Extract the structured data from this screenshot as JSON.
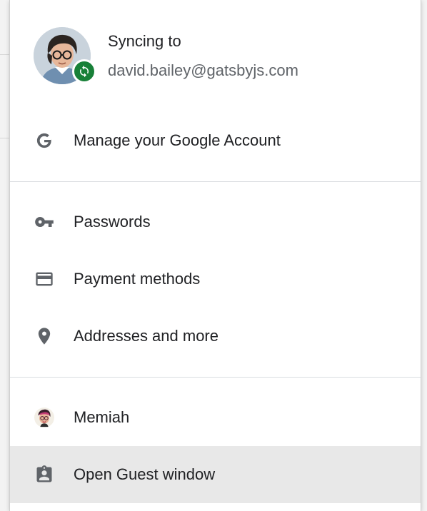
{
  "profile": {
    "sync_title": "Syncing to",
    "email": "david.bailey@gatsbyjs.com",
    "avatar_icon": "user-avatar",
    "badge_icon": "sync-icon",
    "badge_color": "#188038"
  },
  "menu": {
    "manage_account": {
      "label": "Manage your Google Account",
      "icon": "google-g-icon"
    },
    "passwords": {
      "label": "Passwords",
      "icon": "key-icon"
    },
    "payment_methods": {
      "label": "Payment methods",
      "icon": "credit-card-icon"
    },
    "addresses": {
      "label": "Addresses and more",
      "icon": "location-pin-icon"
    },
    "other_profile": {
      "label": "Memiah",
      "icon": "profile-avatar-icon"
    },
    "guest_window": {
      "label": "Open Guest window",
      "icon": "guest-badge-icon"
    }
  },
  "colors": {
    "icon_gray": "#5f6368",
    "text_primary": "#202124",
    "highlight_bg": "#e8e8e8"
  }
}
